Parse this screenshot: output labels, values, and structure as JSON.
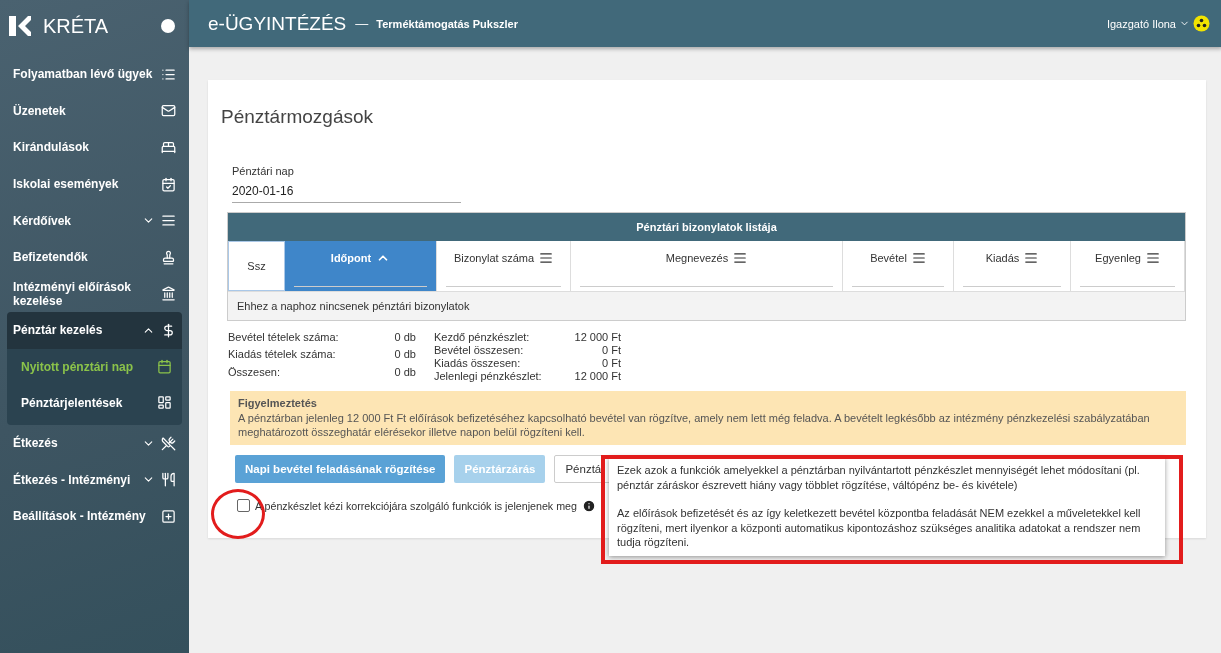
{
  "brand": {
    "name": "KRÉTA"
  },
  "sidebar": {
    "items": [
      {
        "label": "Folyamatban lévő ügyek"
      },
      {
        "label": "Üzenetek"
      },
      {
        "label": "Kirándulások"
      },
      {
        "label": "Iskolai események"
      },
      {
        "label": "Kérdőívek",
        "expanded": false
      },
      {
        "label": "Befizetendők"
      },
      {
        "label": "Intézményi előírások kezelése"
      },
      {
        "label": "Pénztár kezelés",
        "expanded": true,
        "children": [
          {
            "label": "Nyitott pénztári nap",
            "selected": true
          },
          {
            "label": "Pénztárjelentések",
            "selected": false
          }
        ]
      },
      {
        "label": "Étkezés",
        "expanded": false
      },
      {
        "label": "Étkezés - Intézményi",
        "expanded": false
      },
      {
        "label": "Beállítások - Intézmény"
      }
    ]
  },
  "header": {
    "title": "e-ÜGYINTÉZÉS",
    "separator": "—",
    "subtitle": "Terméktámogatás Pukszler",
    "user": "Igazgató Ilona"
  },
  "page": {
    "title": "Pénztármozgások",
    "date_field": {
      "label": "Pénztári nap",
      "value": "2020-01-16"
    },
    "table": {
      "title": "Pénztári bizonylatok listája",
      "columns": [
        {
          "label": "Ssz",
          "sortable": false,
          "selected": false
        },
        {
          "label": "Időpont",
          "sortable": true,
          "selected": true
        },
        {
          "label": "Bizonylat száma",
          "sortable": true,
          "selected": false
        },
        {
          "label": "Megnevezés",
          "sortable": true,
          "selected": false
        },
        {
          "label": "Bevétel",
          "sortable": true,
          "selected": false
        },
        {
          "label": "Kiadás",
          "sortable": true,
          "selected": false
        },
        {
          "label": "Egyenleg",
          "sortable": true,
          "selected": false
        }
      ],
      "empty_message": "Ehhez a naphoz nincsenek pénztári bizonylatok"
    },
    "summary_left": [
      {
        "label": "Bevétel tételek száma:",
        "value": "0 db"
      },
      {
        "label": "Kiadás tételek száma:",
        "value": "0 db"
      },
      {
        "label": "Összesen:",
        "value": "0 db"
      }
    ],
    "summary_right": [
      {
        "label": "Kezdő pénzkészlet:",
        "value": "12 000 Ft"
      },
      {
        "label": "Bevétel összesen:",
        "value": "0 Ft"
      },
      {
        "label": "Kiadás összesen:",
        "value": "0 Ft"
      },
      {
        "label": "Jelenlegi pénzkészlet:",
        "value": "12 000 Ft"
      }
    ],
    "warning": {
      "title": "Figyelmeztetés",
      "text": "A pénztárban jelenleg 12 000 Ft Ft előírások befizetéséhez kapcsolható bevétel van rögzítve, amely nem lett még feladva. A bevételt legkésőbb az intézmény pénzkezelési szabályzatában meghatározott összeghatár elérésekor illetve napon belül rögzíteni kell."
    },
    "buttons": [
      {
        "label": "Napi bevétel feladásának rögzítése",
        "kind": "primary",
        "disabled": false
      },
      {
        "label": "Pénztárzárás",
        "kind": "primary",
        "disabled": true
      },
      {
        "label": "Pénztá",
        "kind": "outline",
        "disabled": false
      }
    ],
    "checkbox": {
      "label": "A pénzkészlet kézi korrekciójára szolgáló funkciók is jelenjenek meg",
      "checked": false
    },
    "tooltip": [
      "Ezek azok a funkciók amelyekkel a pénztárban nyilvántartott pénzkészlet mennyiségét lehet módosítani (pl. pénztár záráskor észrevett hiány vagy többlet rögzítése, váltópénz be- és kivétele)",
      "Az előírások befizetését és az így keletkezett bevétel központba feladását NEM ezekkel a műveletekkel kell rögzíteni, mert ilyenkor a központi automatikus kipontozáshoz szükséges analitika adatokat a rendszer nem tudja rögzíteni."
    ]
  }
}
